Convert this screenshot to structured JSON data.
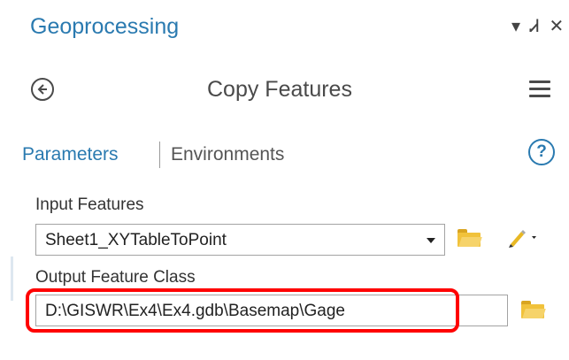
{
  "pane": {
    "title": "Geoprocessing",
    "controls": {
      "options": "▾",
      "pin": "Ꮧ",
      "close": "✕"
    }
  },
  "tool": {
    "title": "Copy Features"
  },
  "tabs": {
    "parameters": "Parameters",
    "environments": "Environments",
    "help": "?"
  },
  "fields": {
    "input_features": {
      "label": "Input Features",
      "value": "Sheet1_XYTableToPoint"
    },
    "output_feature_class": {
      "label": "Output Feature Class",
      "value": "D:\\GISWR\\Ex4\\Ex4.gdb\\Basemap\\Gage"
    }
  },
  "colors": {
    "accent": "#2a7ab0",
    "highlight": "#ff0000",
    "folder": "#f1c23b"
  },
  "icons": [
    "back-arrow-icon",
    "menu-icon",
    "help-icon",
    "folder-icon",
    "pencil-icon",
    "dropdown-arrow-icon"
  ]
}
